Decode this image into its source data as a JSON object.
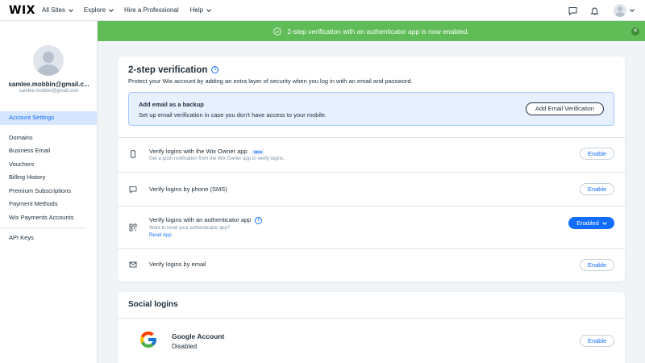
{
  "topbar": {
    "logo": "WIX",
    "nav": [
      {
        "label": "All Sites",
        "has_dropdown": true
      },
      {
        "label": "Explore",
        "has_dropdown": true
      },
      {
        "label": "Hire a Professional",
        "has_dropdown": false
      },
      {
        "label": "Help",
        "has_dropdown": true
      }
    ],
    "icons": [
      "chat-icon",
      "bell-icon",
      "avatar"
    ]
  },
  "sidebar": {
    "user_name": "samlee.mobbin@gmail.c...",
    "user_email": "samlee.mobbin@gmail.com",
    "menu": [
      {
        "label": "Account Settings",
        "active": true
      },
      {
        "label": "Domains"
      },
      {
        "label": "Business Email"
      },
      {
        "label": "Vouchers"
      },
      {
        "label": "Billing History"
      },
      {
        "label": "Premium Subscriptions"
      },
      {
        "label": "Payment Methods"
      },
      {
        "label": "Wix Payments Accounts"
      },
      {
        "label": "API Keys"
      }
    ]
  },
  "banner": {
    "message": "2-step verification with an authenticator app is now enabled.",
    "color": "#60bc57"
  },
  "verification": {
    "title": "2-step verification",
    "subtitle": "Protect your Wix account by adding an extra layer of security when you log in with an email and password.",
    "backup": {
      "title": "Add email as a backup",
      "description": "Set up email verification in case you don’t have access to your mobile.",
      "button": "Add Email Verification"
    },
    "methods": [
      {
        "title": "Verify logins with the Wix Owner app",
        "badge": "NEW",
        "description": "Get a push notification from the Wix Owner app to verify logins.",
        "button": "Enable",
        "icon": "phone-icon"
      },
      {
        "title": "Verify logins by phone (SMS)",
        "button": "Enable",
        "icon": "message-icon"
      },
      {
        "title": "Verify logins with an authenticator app",
        "description": "Want to reset your authenticator app?",
        "link": "Reset App",
        "button": "Enabled",
        "icon": "qr-code-icon"
      },
      {
        "title": "Verify logins by email",
        "button": "Enable",
        "icon": "envelope-icon"
      }
    ]
  },
  "social": {
    "title": "Social logins",
    "google": {
      "title": "Google Account",
      "status": "Disabled",
      "button": "Enable"
    }
  },
  "colors": {
    "accent": "#116dff",
    "active_bg": "#d6e6fe",
    "page_bg": "#f0f4f7"
  }
}
